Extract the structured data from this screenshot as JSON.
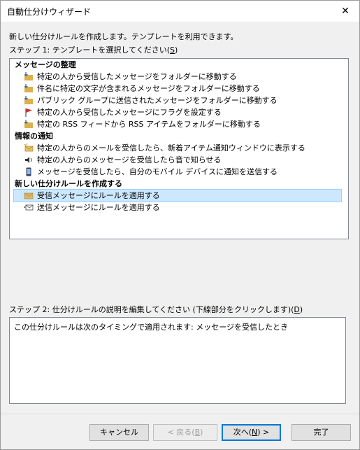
{
  "window": {
    "title": "自動仕分けウィザード",
    "close_glyph": "✕"
  },
  "intro": "新しい仕分けルールを作成します。テンプレートを利用できます。",
  "step1": {
    "text": "ステップ 1: テンプレートを選択してください(",
    "accel": "S",
    "tail": ")"
  },
  "list": {
    "groups": [
      {
        "label": "メッセージの整理",
        "items": [
          {
            "icon": "folder-move-icon",
            "label": "特定の人から受信したメッセージをフォルダーに移動する"
          },
          {
            "icon": "folder-move-icon",
            "label": "件名に特定の文字が含まれるメッセージをフォルダーに移動する"
          },
          {
            "icon": "folder-move-icon",
            "label": "パブリック グループに送信されたメッセージをフォルダーに移動する"
          },
          {
            "icon": "red-flag-icon",
            "label": "特定の人から受信したメッセージにフラグを設定する"
          },
          {
            "icon": "folder-move-icon",
            "label": "特定の RSS フィードから RSS アイテムをフォルダーに移動する"
          }
        ]
      },
      {
        "label": "情報の通知",
        "items": [
          {
            "icon": "new-mail-alert-icon",
            "label": "特定の人からのメールを受信したら、新着アイテム通知ウィンドウに表示する"
          },
          {
            "icon": "speaker-icon",
            "label": "特定の人からのメッセージを受信したら音で知らせる"
          },
          {
            "icon": "mobile-device-icon",
            "label": "メッセージを受信したら、自分のモバイル デバイスに通知を送信する"
          }
        ]
      },
      {
        "label": "新しい仕分けルールを作成する",
        "items": [
          {
            "icon": "incoming-envelope-icon",
            "label": "受信メッセージにルールを適用する",
            "selected": true
          },
          {
            "icon": "outgoing-envelope-icon",
            "label": "送信メッセージにルールを適用する"
          }
        ]
      }
    ]
  },
  "step2": {
    "text": "ステップ 2: 仕分けルールの説明を編集してください (下線部分をクリックします)(",
    "accel": "D",
    "tail": ")"
  },
  "description": "この仕分けルールは次のタイミングで適用されます: メッセージを受信したとき",
  "buttons": {
    "cancel": "キャンセル",
    "back_pre": "< 戻る(",
    "back_accel": "B",
    "back_post": ")",
    "next_pre": "次へ(",
    "next_accel": "N",
    "next_post": ") >",
    "finish": "完了"
  },
  "colors": {
    "selection": "#cce8ff",
    "selection_border": "#99d1ff",
    "folder": "#dcb04a",
    "flag": "#d32f2f",
    "default_button_border": "#0078d7"
  }
}
